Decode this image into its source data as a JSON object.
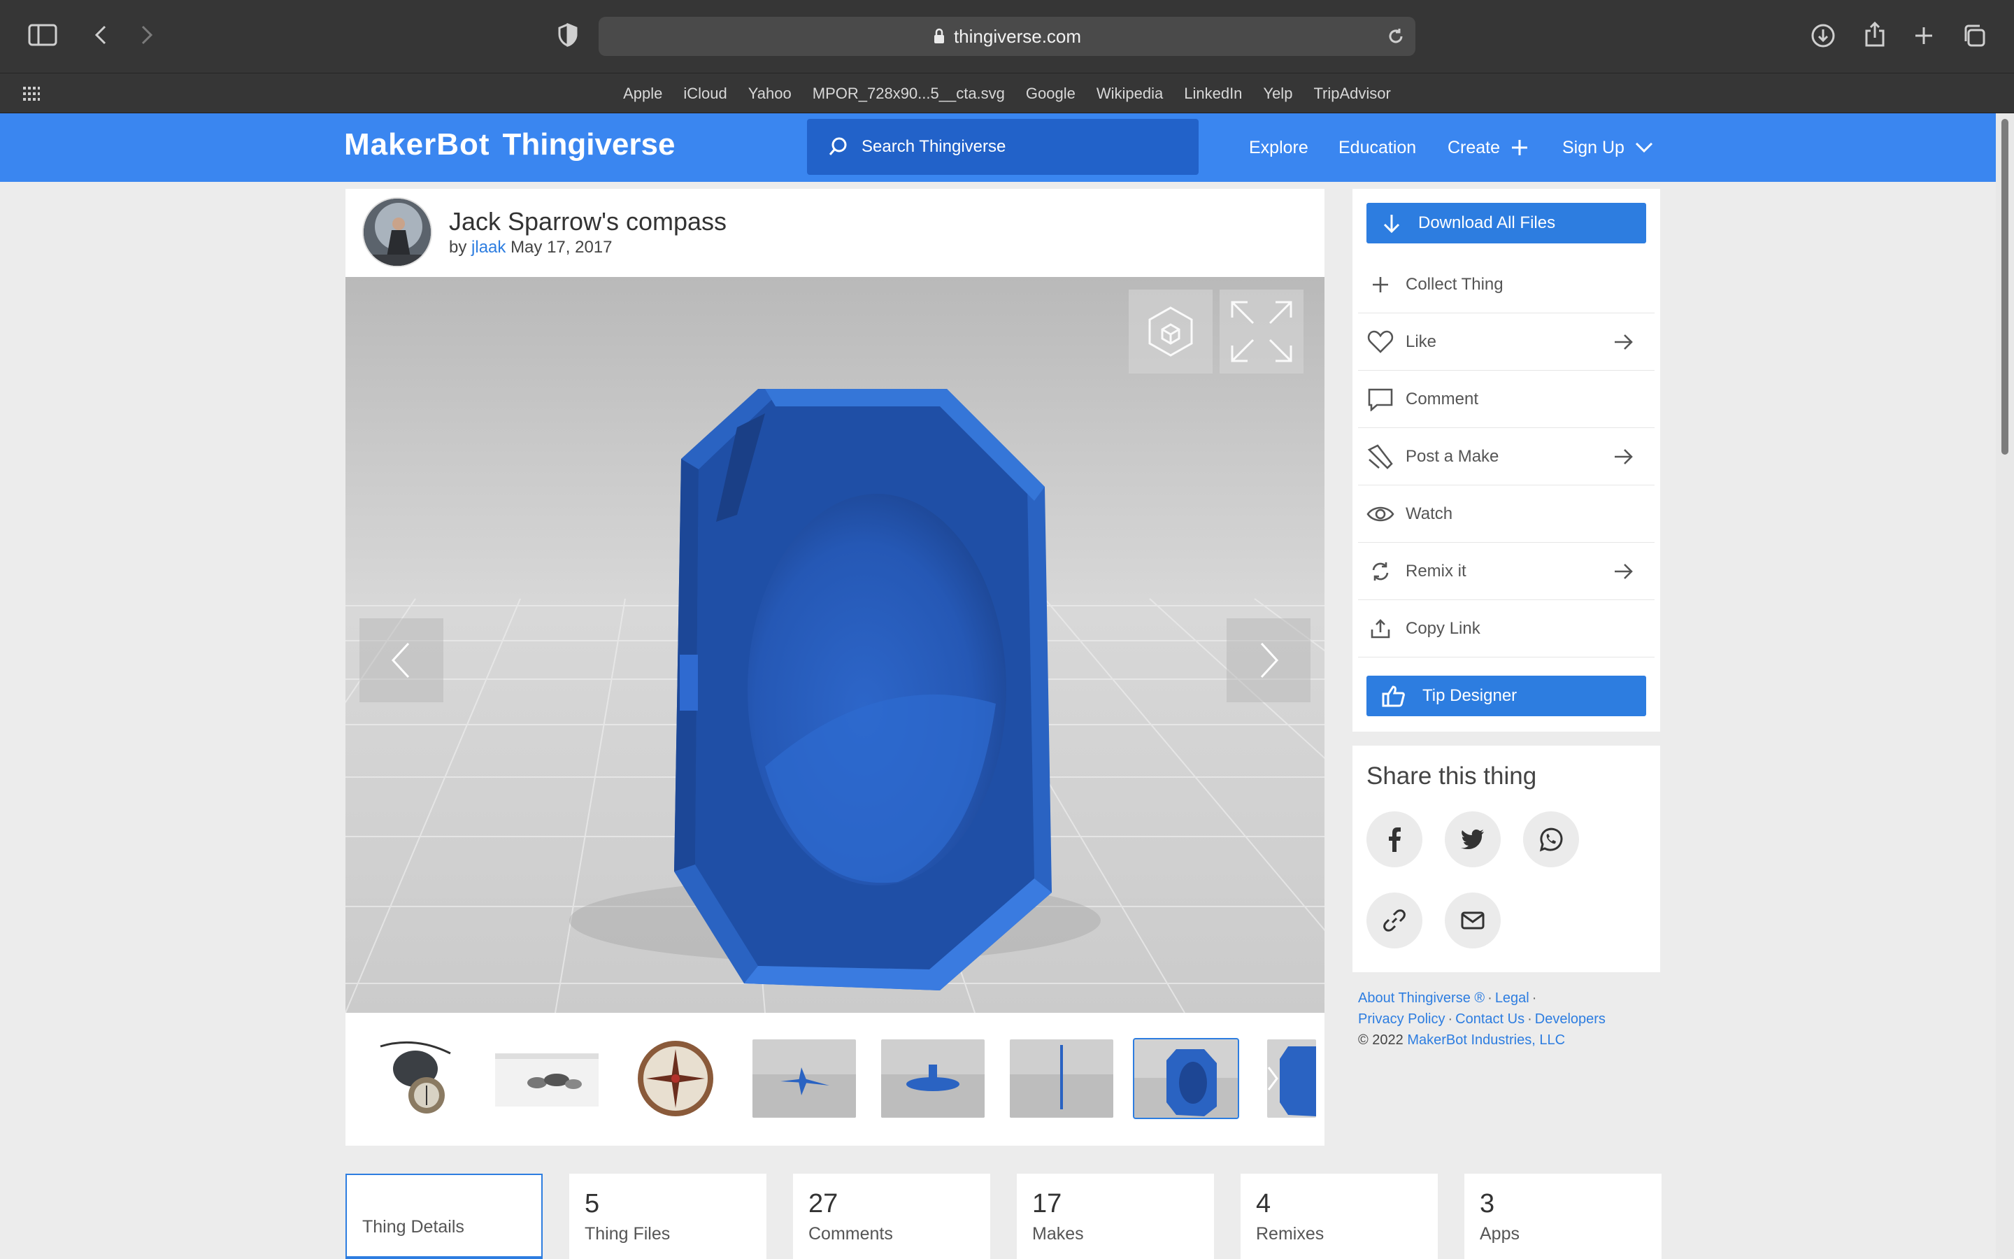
{
  "browser": {
    "url": "thingiverse.com",
    "bookmarks": [
      "Apple",
      "iCloud",
      "Yahoo",
      "MPOR_728x90...5__cta.svg",
      "Google",
      "Wikipedia",
      "LinkedIn",
      "Yelp",
      "TripAdvisor"
    ]
  },
  "header": {
    "logo_part1": "MakerBot",
    "logo_part2": "Thingiverse",
    "search_placeholder": "Search Thingiverse",
    "nav": {
      "explore": "Explore",
      "education": "Education",
      "create": "Create",
      "signup": "Sign Up"
    }
  },
  "thing": {
    "title": "Jack Sparrow's compass",
    "by": "by",
    "author": "jlaak",
    "date": "May 17, 2017"
  },
  "sidebar": {
    "download": "Download All Files",
    "actions": [
      "Collect Thing",
      "Like",
      "Comment",
      "Post a Make",
      "Watch",
      "Remix it",
      "Copy Link"
    ],
    "tip": "Tip Designer"
  },
  "share": {
    "title": "Share this thing"
  },
  "footer": {
    "about": "About Thingiverse ®",
    "legal": "Legal",
    "privacy": "Privacy Policy",
    "contact": "Contact Us",
    "developers": "Developers",
    "copyright_prefix": "©  2022",
    "company": "MakerBot Industries, LLC"
  },
  "stats": [
    {
      "num": "",
      "label": "Thing Details"
    },
    {
      "num": "5",
      "label": "Thing Files"
    },
    {
      "num": "27",
      "label": "Comments"
    },
    {
      "num": "17",
      "label": "Makes"
    },
    {
      "num": "4",
      "label": "Remixes"
    },
    {
      "num": "3",
      "label": "Apps"
    }
  ],
  "colors": {
    "header_blue": "#3a86f0",
    "accent_blue": "#2d7de0",
    "model_blue": "#2a63c2"
  }
}
